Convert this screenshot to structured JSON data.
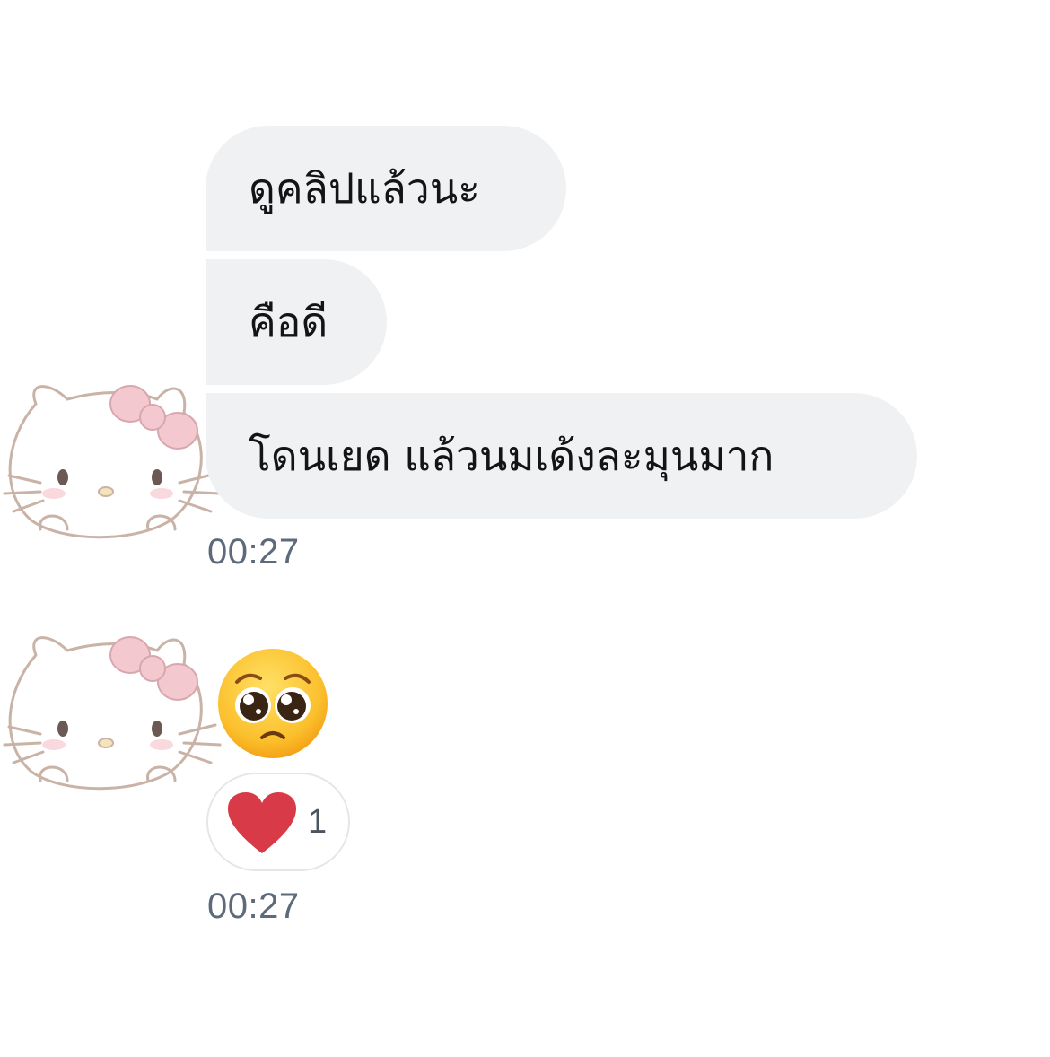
{
  "messages": [
    {
      "text": "ดูคลิปแล้วนะ"
    },
    {
      "text": "คือดี"
    },
    {
      "text": "โดนเยด แล้วนมเด้งละมุนมาก"
    }
  ],
  "timestamps": {
    "first": "00:27",
    "second": "00:27"
  },
  "emoji_message": {
    "icon": "pleading-face-emoji"
  },
  "reaction": {
    "icon": "heart-icon",
    "count": "1",
    "color": "#d83a48"
  },
  "colors": {
    "bubble": "#eff1f3",
    "timestamp": "#5d6a79"
  }
}
